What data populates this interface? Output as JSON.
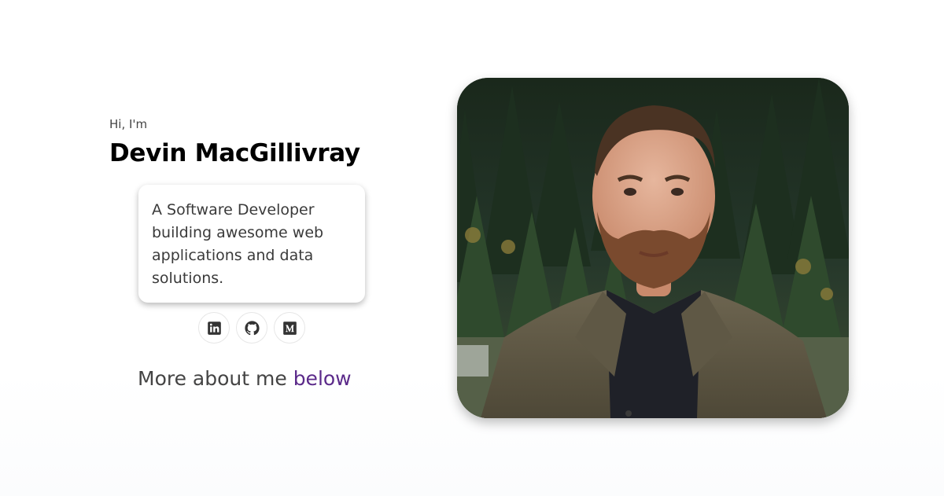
{
  "hero": {
    "greeting": "Hi, I'm",
    "name": "Devin MacGillivray",
    "tagline": "A Software Developer building awesome web applications and data solutions.",
    "more_prefix": "More about me",
    "more_link": "below"
  },
  "socials": [
    {
      "icon": "linkedin-icon"
    },
    {
      "icon": "github-icon"
    },
    {
      "icon": "medium-icon"
    }
  ],
  "colors": {
    "accent": "#5b2a8a",
    "heading": "#000000",
    "text": "#3a3a3a",
    "icon": "#333333"
  }
}
